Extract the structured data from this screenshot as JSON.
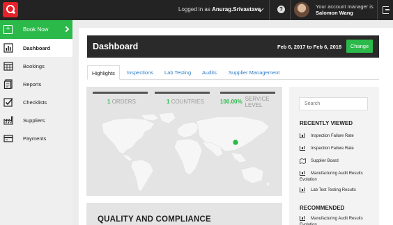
{
  "topbar": {
    "logged_in_prefix": "Logged in as",
    "username": "Anurag.Srivastava",
    "help_label": "?",
    "account_manager_line": "Your account manager is",
    "account_manager_name": "Salomon Wang"
  },
  "sidebar": {
    "book_now": "Book Now",
    "items": [
      {
        "label": "Dashboard",
        "icon": "bar-chart-icon"
      },
      {
        "label": "Bookings",
        "icon": "calendar-icon"
      },
      {
        "label": "Reports",
        "icon": "document-icon"
      },
      {
        "label": "Checklists",
        "icon": "checklist-icon"
      },
      {
        "label": "Suppliers",
        "icon": "factory-icon"
      },
      {
        "label": "Payments",
        "icon": "credit-card-icon"
      }
    ]
  },
  "dashboard": {
    "title": "Dashboard",
    "date_range": "Feb 6, 2017 to Feb 6, 2018",
    "change_label": "Change"
  },
  "tabs": [
    "Highlights",
    "Inspections",
    "Lab Testing",
    "Audits",
    "Supplier Management"
  ],
  "stats": [
    {
      "value": "1",
      "label": "ORDERS"
    },
    {
      "value": "1",
      "label": "COUNTRIES"
    },
    {
      "value": "100.00%",
      "label_line1": "SERVICE",
      "label_line2": "LEVEL"
    }
  ],
  "quality_title": "QUALITY AND COMPLIANCE",
  "right": {
    "search_placeholder": "Search",
    "recently_viewed_title": "RECENTLY VIEWED",
    "recently_viewed": [
      "Inspection Failure Rate",
      "Inspection Failure Rate",
      "Supplier Board",
      "Manufacturing Audit Results Evolution",
      "Lab Test Testing Results"
    ],
    "recommended_title": "RECOMMENDED",
    "recommended": [
      "Manufacturing Audit Results Evolution"
    ]
  },
  "colors": {
    "accent_green": "#2bb94a",
    "brand_red": "#e52229",
    "header_dark": "#232323",
    "link_blue": "#2e7cc4"
  }
}
